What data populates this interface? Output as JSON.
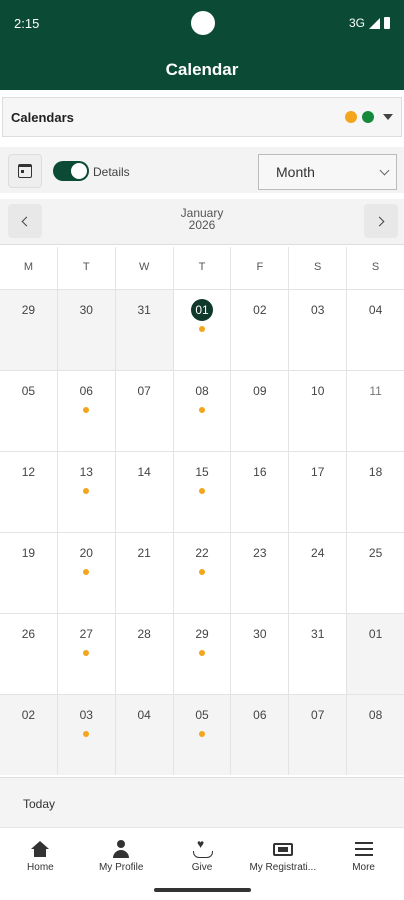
{
  "status_bar": {
    "time": "2:15",
    "network": "3G"
  },
  "app_bar": {
    "title": "Calendar"
  },
  "calendars_bar": {
    "label": "Calendars",
    "colors": [
      "#f3a51c",
      "#16893d"
    ]
  },
  "controls": {
    "details_label": "Details",
    "details_on": true,
    "view_select": "Month"
  },
  "month_nav": {
    "month": "January",
    "year": "2026"
  },
  "weekdays": [
    "M",
    "T",
    "W",
    "T",
    "F",
    "S",
    "S"
  ],
  "weeks": [
    [
      {
        "d": "29",
        "m": true
      },
      {
        "d": "30",
        "m": true
      },
      {
        "d": "31",
        "m": true
      },
      {
        "d": "01",
        "t": true,
        "e": true
      },
      {
        "d": "02"
      },
      {
        "d": "03"
      },
      {
        "d": "04"
      }
    ],
    [
      {
        "d": "05"
      },
      {
        "d": "06",
        "e": true
      },
      {
        "d": "07"
      },
      {
        "d": "08",
        "e": true
      },
      {
        "d": "09"
      },
      {
        "d": "10"
      },
      {
        "d": "11",
        "w": true
      }
    ],
    [
      {
        "d": "12"
      },
      {
        "d": "13",
        "e": true
      },
      {
        "d": "14"
      },
      {
        "d": "15",
        "e": true
      },
      {
        "d": "16"
      },
      {
        "d": "17"
      },
      {
        "d": "18"
      }
    ],
    [
      {
        "d": "19"
      },
      {
        "d": "20",
        "e": true
      },
      {
        "d": "21"
      },
      {
        "d": "22",
        "e": true
      },
      {
        "d": "23"
      },
      {
        "d": "24"
      },
      {
        "d": "25"
      }
    ],
    [
      {
        "d": "26"
      },
      {
        "d": "27",
        "e": true
      },
      {
        "d": "28"
      },
      {
        "d": "29",
        "e": true
      },
      {
        "d": "30"
      },
      {
        "d": "31"
      },
      {
        "d": "01",
        "m": true
      }
    ],
    [
      {
        "d": "02",
        "m": true
      },
      {
        "d": "03",
        "m": true,
        "e": true
      },
      {
        "d": "04",
        "m": true
      },
      {
        "d": "05",
        "m": true,
        "e": true
      },
      {
        "d": "06",
        "m": true
      },
      {
        "d": "07",
        "m": true
      },
      {
        "d": "08",
        "m": true
      }
    ]
  ],
  "today_label": "Today",
  "tabs": [
    {
      "label": "Home",
      "icon": "home-icon"
    },
    {
      "label": "My Profile",
      "icon": "user-icon"
    },
    {
      "label": "Give",
      "icon": "give-icon"
    },
    {
      "label": "My Registrati...",
      "icon": "ticket-icon"
    },
    {
      "label": "More",
      "icon": "menu-icon"
    }
  ]
}
